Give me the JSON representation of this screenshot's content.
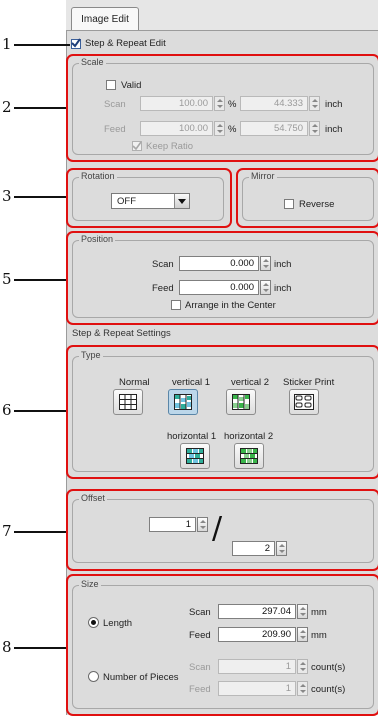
{
  "tab_label": "Image Edit",
  "callouts": [
    "1",
    "2",
    "3",
    "5",
    "6",
    "7",
    "8"
  ],
  "step_repeat_edit": {
    "label": "Step & Repeat Edit",
    "checked": true
  },
  "scale": {
    "title": "Scale",
    "valid_label": "Valid",
    "scan_label": "Scan",
    "scan_percent": "100.00",
    "scan_value": "44.333",
    "feed_label": "Feed",
    "feed_percent": "100.00",
    "feed_value": "54.750",
    "percent_unit": "%",
    "inch_unit": "inch",
    "keep_ratio_label": "Keep Ratio"
  },
  "rotation": {
    "title": "Rotation",
    "value": "OFF"
  },
  "mirror": {
    "title": "Mirror",
    "reverse_label": "Reverse"
  },
  "position": {
    "title": "Position",
    "scan_label": "Scan",
    "scan_value": "0.000",
    "feed_label": "Feed",
    "feed_value": "0.000",
    "unit": "inch",
    "arrange_label": "Arrange in the Center"
  },
  "step_repeat_settings": {
    "title": "Step & Repeat Settings"
  },
  "type": {
    "title": "Type",
    "labels": [
      "Normal",
      "vertical 1",
      "vertical 2",
      "Sticker Print",
      "horizontal 1",
      "horizontal 2"
    ],
    "selected": "vertical 1"
  },
  "offset": {
    "title": "Offset",
    "value1": "1",
    "value2": "2",
    "divider": "/"
  },
  "size": {
    "title": "Size",
    "length_label": "Length",
    "pieces_label": "Number of Pieces",
    "scan_label": "Scan",
    "feed_label": "Feed",
    "length_scan": "297.04",
    "length_feed": "209.90",
    "mm_unit": "mm",
    "pieces_scan": "1",
    "pieces_feed": "1",
    "count_unit": "count(s)",
    "selected": "Length"
  },
  "colors": {
    "callout_border": "#e01010",
    "selected_type": "#bcd7ea"
  }
}
